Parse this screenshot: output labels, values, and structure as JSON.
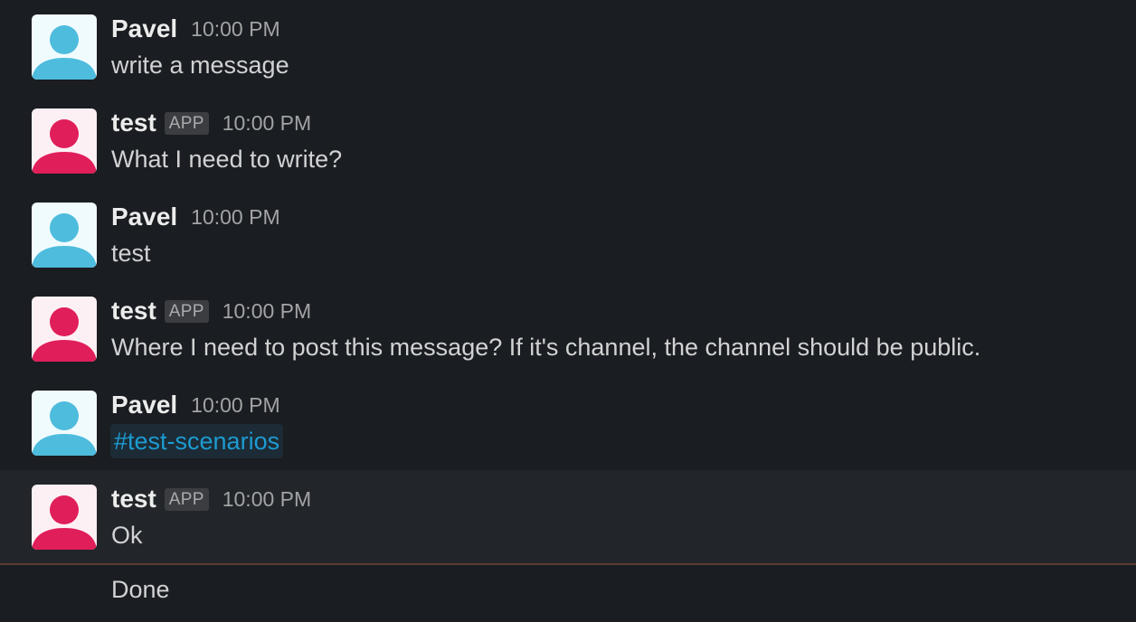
{
  "colors": {
    "background": "#1a1d21",
    "hover_row": "#222529",
    "user_avatar": "#4ebcdc",
    "app_avatar": "#e01e5a",
    "channel_link": "#1d9bd1",
    "divider": "#5b3a33"
  },
  "messages": [
    {
      "author": "Pavel",
      "time": "10:00 PM",
      "text": "write a message",
      "avatar": "person-icon"
    },
    {
      "author": "test",
      "badge": "APP",
      "time": "10:00 PM",
      "text": "What I need to write?",
      "avatar": "person-icon"
    },
    {
      "author": "Pavel",
      "time": "10:00 PM",
      "text": "test",
      "avatar": "person-icon"
    },
    {
      "author": "test",
      "badge": "APP",
      "time": "10:00 PM",
      "text": "Where I need to post this message? If it's channel, the channel should be public.",
      "avatar": "person-icon"
    },
    {
      "author": "Pavel",
      "time": "10:00 PM",
      "text": "#test-scenarios",
      "avatar": "person-icon"
    },
    {
      "author": "test",
      "badge": "APP",
      "time": "10:00 PM",
      "text": "Ok",
      "avatar": "person-icon"
    }
  ],
  "status_text": "Done"
}
